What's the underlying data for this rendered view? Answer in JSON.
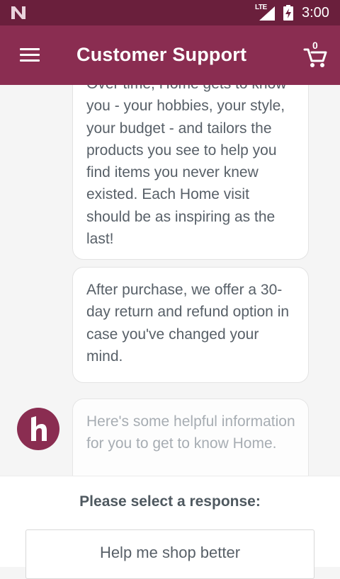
{
  "status_bar": {
    "network_label": "LTE",
    "time": "3:00",
    "icons": [
      "notification-n-icon",
      "signal-icon",
      "battery-charging-icon"
    ]
  },
  "app_bar": {
    "title": "Customer Support",
    "menu_icon": "hamburger-menu-icon",
    "cart_icon": "shopping-cart-icon",
    "cart_count": "0"
  },
  "messages": [
    {
      "text": "Over time, Home gets to know you - your hobbies, your style, your budget - and tailors the products you see to help you find items you never knew existed. Each Home visit should be as inspiring as the last!"
    },
    {
      "text": "After purchase, we offer a 30-day return and refund option in case you've changed your mind."
    },
    {
      "text": "Here's some helpful information for you to get to know Home."
    }
  ],
  "avatar": {
    "letter": "h",
    "icon": "home-logo-icon"
  },
  "response_panel": {
    "prompt": "Please select a response:",
    "options": [
      "Help me shop better"
    ]
  },
  "colors": {
    "status_bar": "#6a1f3c",
    "app_bar": "#8a2d51",
    "background": "#f5f5f5",
    "bubble_text": "#586068"
  }
}
